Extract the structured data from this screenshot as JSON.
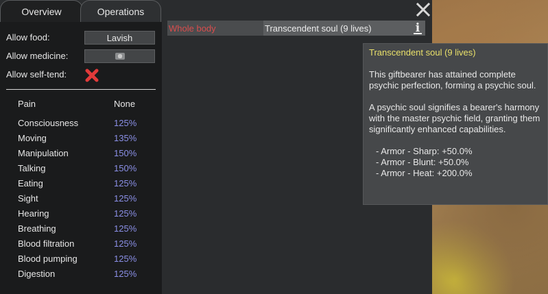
{
  "tabs": [
    {
      "label": "Overview",
      "selected": true
    },
    {
      "label": "Operations",
      "selected": false
    }
  ],
  "settings": {
    "allow_food_label": "Allow food:",
    "allow_food_value": "Lavish",
    "allow_medicine_label": "Allow medicine:",
    "allow_medicine_icon": "medicine-icon",
    "allow_self_tend_label": "Allow self-tend:",
    "allow_self_tend_icon": "red-x-icon"
  },
  "capacities": {
    "pain_label": "Pain",
    "pain_value": "None",
    "rows": [
      {
        "label": "Consciousness",
        "value": "125%"
      },
      {
        "label": "Moving",
        "value": "135%"
      },
      {
        "label": "Manipulation",
        "value": "150%"
      },
      {
        "label": "Talking",
        "value": "150%"
      },
      {
        "label": "Eating",
        "value": "125%"
      },
      {
        "label": "Sight",
        "value": "125%"
      },
      {
        "label": "Hearing",
        "value": "125%"
      },
      {
        "label": "Breathing",
        "value": "125%"
      },
      {
        "label": "Blood filtration",
        "value": "125%"
      },
      {
        "label": "Blood pumping",
        "value": "125%"
      },
      {
        "label": "Digestion",
        "value": "125%"
      }
    ]
  },
  "hediff": {
    "body_part": "Whole body",
    "name": "Transcendent soul (9 lives)",
    "info_icon": "info-icon"
  },
  "tooltip": {
    "title": "Transcendent soul (9 lives)",
    "para1": "This giftbearer has attained complete psychic perfection, forming a psychic soul.",
    "para2": "A psychic soul signifies a bearer's harmony with the master psychic field, granting them significantly enhanced capabilities.",
    "stats": [
      "- Armor - Sharp: +50.0%",
      "- Armor - Blunt: +50.0%",
      "- Armor - Heat: +200.0%"
    ]
  },
  "colors": {
    "percent_value": "#8a8fe6",
    "body_part": "#d84d4d",
    "tooltip_title": "#e9e06a"
  }
}
